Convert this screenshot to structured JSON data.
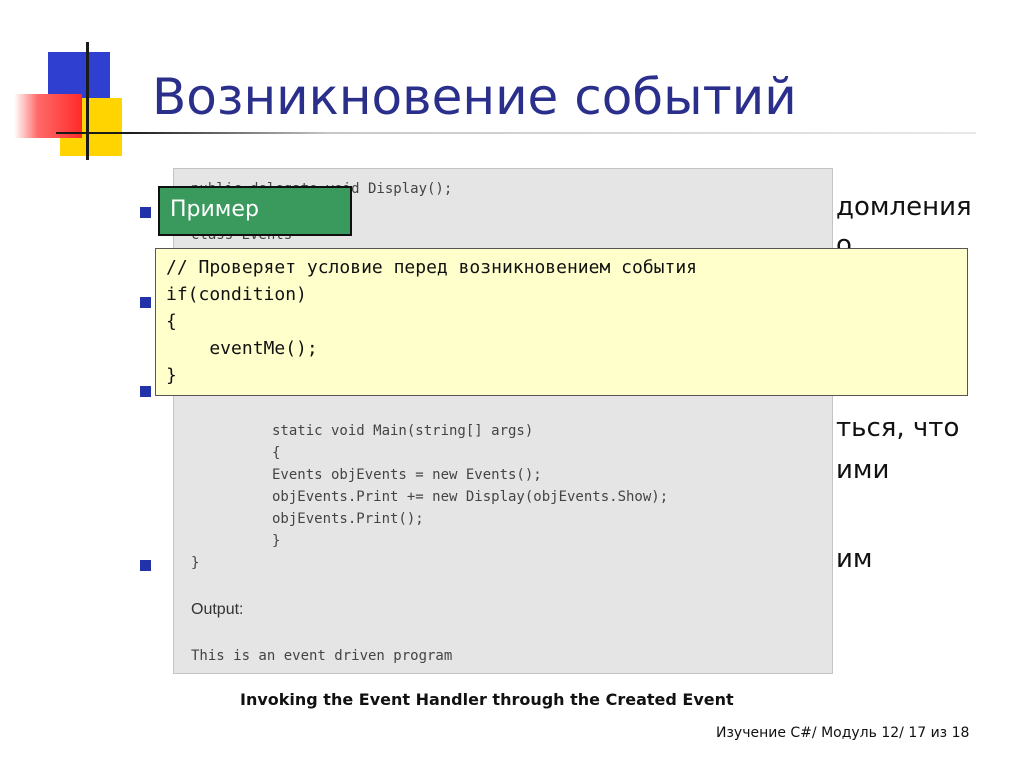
{
  "slide": {
    "title": "Возникновение событий",
    "footer": "Изучение C#/ Модуль 12/ 17 из 18"
  },
  "bullet_fragments": [
    "домления",
    "о",
    "ться, что",
    "ими",
    "им"
  ],
  "code_figure": {
    "lines": [
      "public delegate void Display();",
      "class Events",
      "static void Main(string[] args)",
      "{",
      "Events objEvents = new Events();",
      "objEvents.Print += new Display(objEvents.Show);",
      "objEvents.Print();",
      "}",
      "}"
    ],
    "output_label": "Output:",
    "output_text": "This is an event driven program",
    "caption": "Invoking the Event Handler through the Created Event"
  },
  "example_label": "Пример",
  "example_code": [
    "// Проверяет условие перед возникновением события",
    "if(condition)",
    "{",
    "    eventMe();",
    "}"
  ],
  "colors": {
    "title": "#2b2f8c",
    "bullet": "#2233aa",
    "example_label_bg": "#3a9a5e",
    "example_code_bg": "#ffffcc"
  }
}
